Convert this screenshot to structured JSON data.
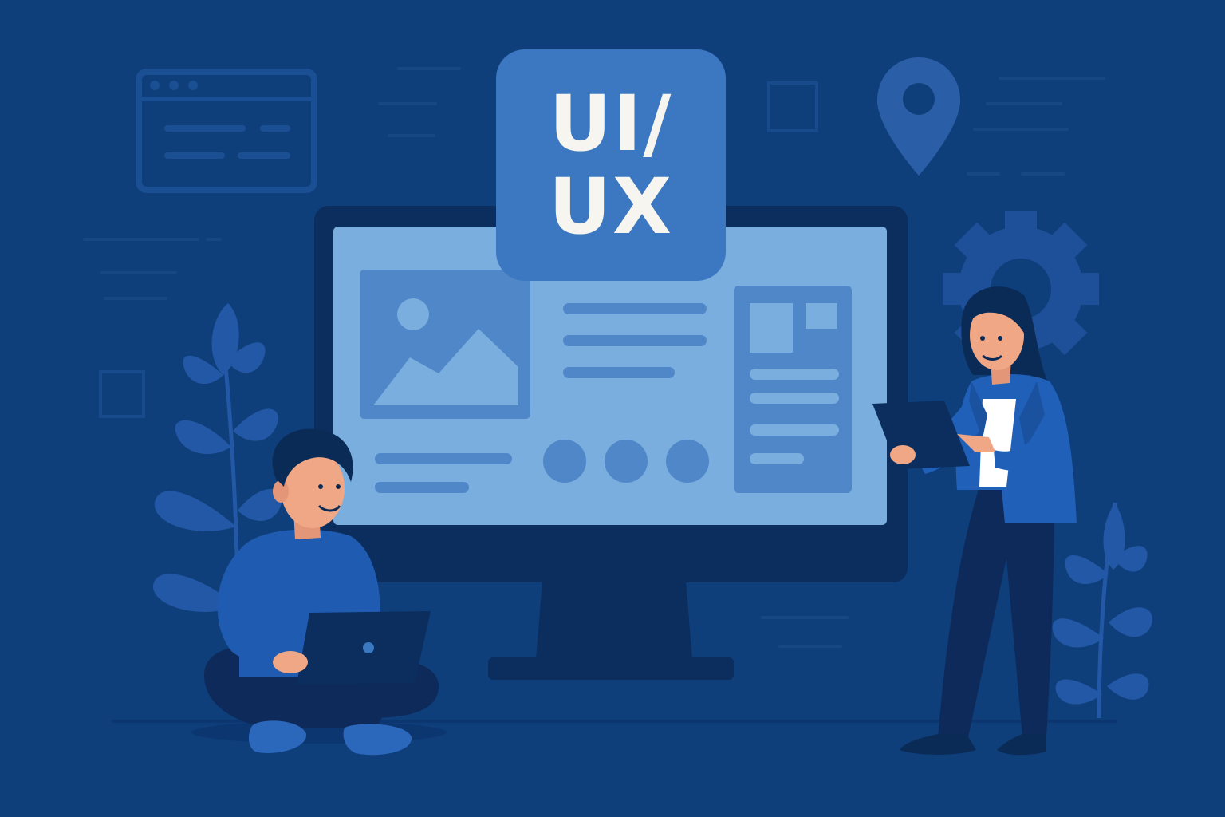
{
  "badge": {
    "line1": "UI/",
    "line2": "UX"
  },
  "colors": {
    "background": "#0f3f7b",
    "background_shapes": "#184b8c",
    "monitor_frame": "#0b2e5e",
    "screen": "#7aaede",
    "screen_card": "#4f87c8",
    "badge": "#3b78c1",
    "badge_text": "#f7f5ef",
    "plant": "#2358a6",
    "skin": "#f0a786",
    "hair": "#0b2b57",
    "sweater": "#1f5cb1",
    "pants": "#0d2a5a",
    "blazer": "#2060b8",
    "shirt": "#ffffff"
  },
  "icons": [
    "browser-window-icon",
    "location-pin-icon",
    "gear-icon",
    "image-placeholder-icon",
    "laptop-icon",
    "tablet-icon"
  ]
}
